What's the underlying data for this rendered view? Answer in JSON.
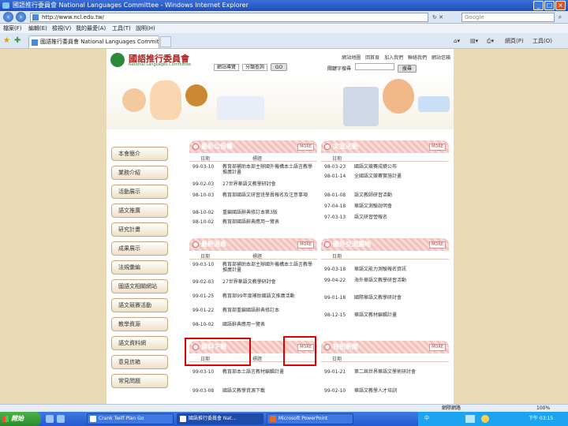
{
  "window": {
    "title": "國語推行委員會 National Languages Committee - Windows Internet Explorer"
  },
  "address": {
    "url": "http://www.ncl.edu.tw/",
    "search_placeholder": "Google"
  },
  "menu": [
    "檔案(F)",
    "編輯(E)",
    "檢視(V)",
    "我的最愛(A)",
    "工具(T)",
    "說明(H)"
  ],
  "tab": {
    "label": "國語推行委員會 National Languages Committee"
  },
  "toolbar": {
    "home": "首頁",
    "page": "網頁(P)",
    "tools": "工具(O)"
  },
  "site": {
    "logo_title": "國語推行委員會",
    "logo_en": "National Languages Committee",
    "top_links": [
      "網站地圖",
      "回首頁",
      "加入我們",
      "聯絡我們",
      "網站信箱"
    ],
    "select1": "網站導覽",
    "select2": "分類查詢",
    "go": "GO",
    "search_label": "關鍵字搜尋",
    "search_go": "搜尋"
  },
  "sidebar": [
    "本會簡介",
    "業務介紹",
    "活動展示",
    "語文推廣",
    "研究計畫",
    "成果展示",
    "法規彙編",
    "國語文相關網站",
    "語文競賽活動",
    "教學資源",
    "語文資料網",
    "意見信箱",
    "常見問題"
  ],
  "panels": {
    "news": {
      "title": "最新公告欄",
      "more": "MORE",
      "col_date": "日期",
      "col_title": "標題",
      "rows": [
        {
          "date": "99-03-10",
          "title": "教育部補助本部主辦國外機構本土語言教學推廣計畫"
        },
        {
          "date": "99-02-03",
          "title": "27世界華語文教學研討會"
        },
        {
          "date": "98-10-03",
          "title": "教育部國語文研習班學員報名及注意事項"
        },
        {
          "date": "98-10-02",
          "title": "重編國語辭典修訂本第3版"
        },
        {
          "date": "98-10-02",
          "title": "教育部國語辭典應用一覽表"
        }
      ]
    },
    "activity": {
      "title": "文宣活動",
      "more": "MORE",
      "col_date": "日期",
      "rows": [
        {
          "date": "98-03-23",
          "title": "國語文競賽成績公布"
        },
        {
          "date": "98-01-14",
          "title": "全國語文競賽實施計畫"
        },
        {
          "date": "98-01-08",
          "title": "語文教師研習活動"
        },
        {
          "date": "97-04-18",
          "title": "華語文測驗說明會"
        },
        {
          "date": "97-03-13",
          "title": "語文研習營報名"
        }
      ]
    },
    "latest": {
      "title": "最新消息",
      "more": "MORE",
      "col_date": "日期",
      "col_title": "標題",
      "rows": [
        {
          "date": "99-03-10",
          "title": "教育部補助本部主辦國外機構本土語言教學推廣計畫"
        },
        {
          "date": "99-02-03",
          "title": "27世界華語文教學研討會"
        },
        {
          "date": "99-01-25",
          "title": "教育部99年度補助國語文推廣活動"
        },
        {
          "date": "99-01-22",
          "title": "教育部重編國語辭典修訂本"
        },
        {
          "date": "98-10-02",
          "title": "國語辭典應用一覽表"
        }
      ]
    },
    "international": {
      "title": "國外交流園地",
      "more": "MORE",
      "col_date": "日期",
      "rows": [
        {
          "date": "99-03-18",
          "title": "華語文能力測驗報名資訊"
        },
        {
          "date": "99-04-22",
          "title": "海外華語文教學研習活動"
        },
        {
          "date": "99-01-18",
          "title": "國際華語文教學研討會"
        },
        {
          "date": "98-12-15",
          "title": "華語文教材編輯計畫"
        }
      ]
    },
    "download": {
      "title": "資料下載",
      "more": "MORE",
      "col_date": "日期",
      "col_title": "標題",
      "rows": [
        {
          "date": "99-03-10",
          "title": "教育部本土語言教材編輯計畫"
        },
        {
          "date": "99-03-08",
          "title": "國語文教學資源下載"
        }
      ]
    },
    "special": {
      "title": "特別新聞",
      "more": "MORE",
      "col_date": "日期",
      "rows": [
        {
          "date": "99-01-21",
          "title": "第二屆世界華語文學術研討會"
        },
        {
          "date": "99-02-10",
          "title": "華語文教學人才培訓"
        }
      ]
    }
  },
  "status": {
    "zone": "網際網路",
    "zoom": "100%"
  },
  "taskbar": {
    "start": "開始",
    "tasks": [
      "Crank Twilf Plan Go",
      "國語推行委員會 Nat...",
      "Microsoft PowerPoint"
    ],
    "tray_lang": "中",
    "clock": "下午 03:15"
  }
}
